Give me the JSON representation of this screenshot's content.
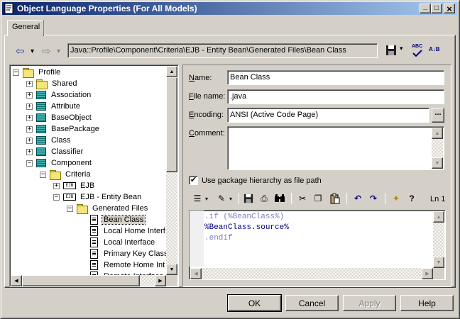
{
  "window": {
    "title": "Object Language Properties (For All Models)",
    "buttons": {
      "minimize": "_",
      "maximize": "□",
      "close": "×"
    }
  },
  "tabs": [
    {
      "label": "General",
      "active": true
    }
  ],
  "nav": {
    "back_glyph": "⇦",
    "forward_glyph": "⇨",
    "dropdown_glyph": "▾",
    "path": "Java::Profile\\Component\\Criteria\\EJB - Entity Bean\\Generated Files\\Bean Class"
  },
  "tree": {
    "items": [
      {
        "label": "Profile",
        "expander": "−",
        "icon": "folder",
        "level": 0
      },
      {
        "label": "Shared",
        "expander": "+",
        "icon": "folder",
        "level": 1
      },
      {
        "label": "Association",
        "expander": "+",
        "icon": "metaclass",
        "level": 1
      },
      {
        "label": "Attribute",
        "expander": "+",
        "icon": "metaclass",
        "level": 1
      },
      {
        "label": "BaseObject",
        "expander": "+",
        "icon": "metaclass",
        "level": 1
      },
      {
        "label": "BasePackage",
        "expander": "+",
        "icon": "metaclass",
        "level": 1
      },
      {
        "label": "Class",
        "expander": "+",
        "icon": "metaclass",
        "level": 1
      },
      {
        "label": "Classifier",
        "expander": "+",
        "icon": "metaclass",
        "level": 1
      },
      {
        "label": "Component",
        "expander": "−",
        "icon": "metaclass",
        "level": 1
      },
      {
        "label": "Criteria",
        "expander": "−",
        "icon": "folder",
        "level": 2
      },
      {
        "label": "EJB",
        "expander": "+",
        "icon": "ejb",
        "level": 3
      },
      {
        "label": "EJB - Entity Bean",
        "expander": "−",
        "icon": "ejb",
        "level": 3
      },
      {
        "label": "Generated Files",
        "expander": "−",
        "icon": "folder",
        "level": 4
      },
      {
        "label": "Bean Class",
        "expander": "",
        "icon": "doc",
        "level": 5,
        "selected": true
      },
      {
        "label": "Local Home Interf",
        "expander": "",
        "icon": "doc",
        "level": 5
      },
      {
        "label": "Local Interface",
        "expander": "",
        "icon": "doc",
        "level": 5
      },
      {
        "label": "Primary Key Class",
        "expander": "",
        "icon": "doc",
        "level": 5
      },
      {
        "label": "Remote Home Int",
        "expander": "",
        "icon": "doc",
        "level": 5
      },
      {
        "label": "Remote Interface",
        "expander": "",
        "icon": "doc",
        "level": 5
      }
    ],
    "ejb_icon_text": "EJB"
  },
  "form": {
    "name_label_u": "N",
    "name_label_rest": "ame:",
    "name_value": "Bean Class",
    "filename_label_u": "F",
    "filename_label_rest": "ile name:",
    "filename_value": ".java",
    "encoding_label_u": "E",
    "encoding_label_rest": "ncoding:",
    "encoding_value": "ANSI (Active Code Page)",
    "encoding_button": "...",
    "comment_label_u": "C",
    "comment_label_rest": "omment:",
    "comment_value": "",
    "checkbox_label_pre": "Use ",
    "checkbox_label_u": "p",
    "checkbox_label_rest": "ackage hierarchy as file path",
    "checkbox_checked": "✔"
  },
  "editor": {
    "line_indicator": "Ln 1",
    "code_lines": [
      {
        "text": ".if (%BeanClass%)",
        "color": "#8080c0"
      },
      {
        "text": "%BeanClass.source%",
        "color": "#000080"
      },
      {
        "text": ".endif",
        "color": "#8080c0"
      }
    ],
    "toolbar_glyphs": {
      "list": "☰",
      "edit": "✎",
      "save": "▣",
      "print": "⎙",
      "find": "⚲",
      "cut": "✂",
      "copy": "❐",
      "paste": "📋",
      "undo": "↶",
      "redo": "↷",
      "insert": "✦",
      "help": "?"
    }
  },
  "toolbar_right": {
    "save_glyph": "▣",
    "spell_glyph": "ABC",
    "sort_glyph": "A↓B"
  },
  "buttons": {
    "ok": "OK",
    "cancel": "Cancel",
    "apply": "Apply",
    "help": "Help"
  },
  "colors": {
    "titlebar_start": "#0a246a",
    "titlebar_end": "#a6caf0",
    "face": "#d4d0c8"
  }
}
